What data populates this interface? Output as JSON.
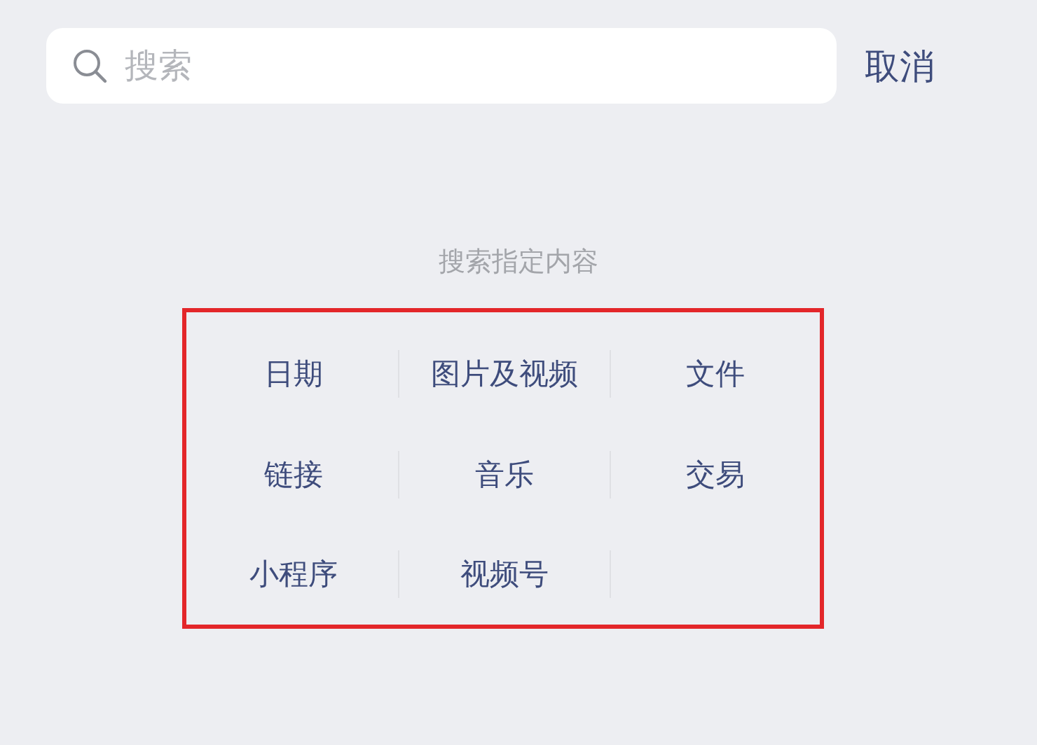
{
  "search": {
    "placeholder": "搜索"
  },
  "cancel_button": "取消",
  "section_title": "搜索指定内容",
  "categories": [
    [
      "日期",
      "图片及视频",
      "文件"
    ],
    [
      "链接",
      "音乐",
      "交易"
    ],
    [
      "小程序",
      "视频号"
    ]
  ]
}
